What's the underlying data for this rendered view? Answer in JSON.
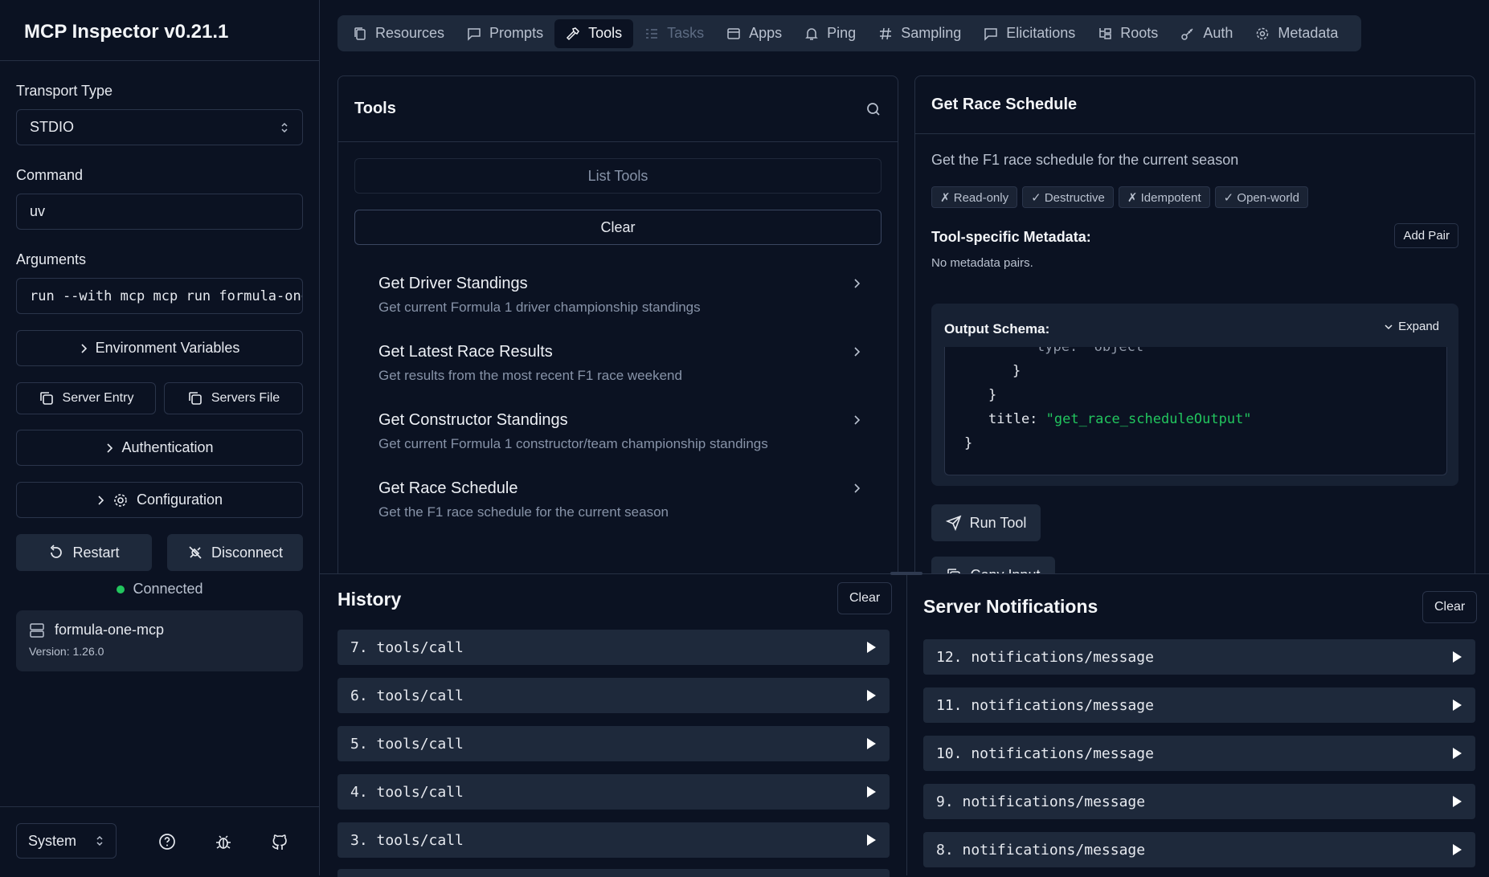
{
  "sidebar": {
    "title": "MCP Inspector v0.21.1",
    "transport_label": "Transport Type",
    "transport_value": "STDIO",
    "command_label": "Command",
    "command_value": "uv",
    "arguments_label": "Arguments",
    "arguments_value": "run --with mcp mcp run formula-one",
    "env_vars": "Environment Variables",
    "server_entry": "Server Entry",
    "servers_file": "Servers File",
    "authentication": "Authentication",
    "configuration": "Configuration",
    "restart": "Restart",
    "disconnect": "Disconnect",
    "status": "Connected",
    "server_name": "formula-one-mcp",
    "server_version": "Version: 1.26.0",
    "theme": "System"
  },
  "tabs": [
    {
      "label": "Resources",
      "icon": "files-icon"
    },
    {
      "label": "Prompts",
      "icon": "message-icon"
    },
    {
      "label": "Tools",
      "icon": "hammer-icon"
    },
    {
      "label": "Tasks",
      "icon": "list-icon"
    },
    {
      "label": "Apps",
      "icon": "window-icon"
    },
    {
      "label": "Ping",
      "icon": "bell-icon"
    },
    {
      "label": "Sampling",
      "icon": "hash-icon"
    },
    {
      "label": "Elicitations",
      "icon": "message-icon"
    },
    {
      "label": "Roots",
      "icon": "folder-tree-icon"
    },
    {
      "label": "Auth",
      "icon": "key-icon"
    },
    {
      "label": "Metadata",
      "icon": "gear-icon"
    }
  ],
  "tools_panel": {
    "title": "Tools",
    "list_tools": "List Tools",
    "clear": "Clear",
    "items": [
      {
        "name": "Get Driver Standings",
        "desc": "Get current Formula 1 driver championship standings"
      },
      {
        "name": "Get Latest Race Results",
        "desc": "Get results from the most recent F1 race weekend"
      },
      {
        "name": "Get Constructor Standings",
        "desc": "Get current Formula 1 constructor/team championship standings"
      },
      {
        "name": "Get Race Schedule",
        "desc": "Get the F1 race schedule for the current season"
      }
    ]
  },
  "detail": {
    "title": "Get Race Schedule",
    "description": "Get the F1 race schedule for the current season",
    "badges": [
      "✗ Read-only",
      "✓ Destructive",
      "✗ Idempotent",
      "✓ Open-world"
    ],
    "metadata_label": "Tool-specific Metadata:",
    "add_pair": "Add Pair",
    "no_pairs": "No metadata pairs.",
    "schema_label": "Output Schema:",
    "expand": "Expand",
    "code": {
      "partial": "type: \"object\"",
      "brace1": "}",
      "brace2": "}",
      "title_key": "title:",
      "title_val": "\"get_race_scheduleOutput\"",
      "brace3": "}"
    },
    "run_tool": "Run Tool",
    "copy_input": "Copy Input"
  },
  "history": {
    "title": "History",
    "clear": "Clear",
    "rows": [
      "7. tools/call",
      "6. tools/call",
      "5. tools/call",
      "4. tools/call",
      "3. tools/call"
    ]
  },
  "notifications": {
    "title": "Server Notifications",
    "clear": "Clear",
    "rows": [
      "12. notifications/message",
      "11. notifications/message",
      "10. notifications/message",
      "9. notifications/message",
      "8. notifications/message"
    ]
  },
  "colors": {
    "background": "#0b1222",
    "surface": "#1e293b",
    "border": "#263044",
    "connected": "#22c55e",
    "json_string": "#22c55e"
  }
}
